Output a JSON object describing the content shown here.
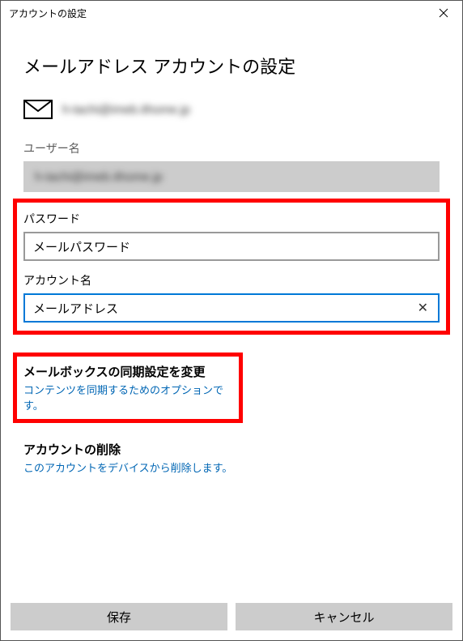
{
  "titlebar": {
    "title": "アカウントの設定"
  },
  "heading": "メールアドレス アカウントの設定",
  "email_display": "h-tachi@imeb.ithome.jp",
  "username": {
    "label": "ユーザー名",
    "value": "h-tachi@imeb.ithome.jp"
  },
  "password": {
    "label": "パスワード",
    "value": "メールパスワード"
  },
  "account_name": {
    "label": "アカウント名",
    "value": "メールアドレス"
  },
  "sync_section": {
    "title": "メールボックスの同期設定を変更",
    "subtitle": "コンテンツを同期するためのオプションです。"
  },
  "delete_section": {
    "title": "アカウントの削除",
    "subtitle": "このアカウントをデバイスから削除します。"
  },
  "footer": {
    "save": "保存",
    "cancel": "キャンセル"
  }
}
